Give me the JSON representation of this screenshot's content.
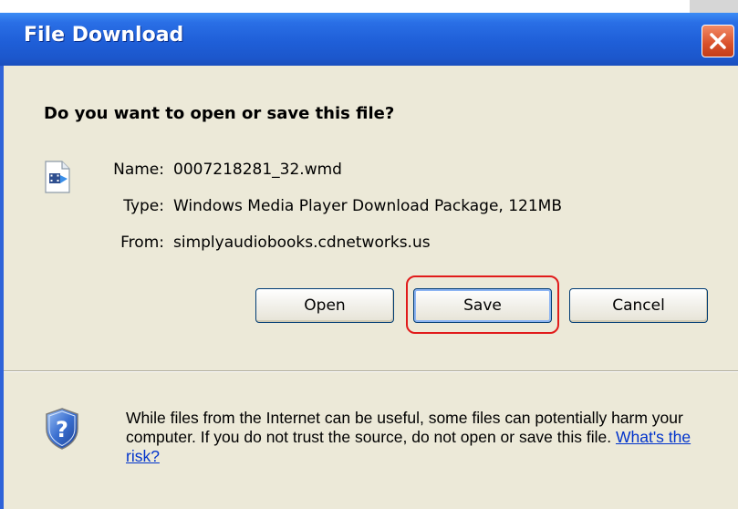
{
  "window": {
    "title": "File Download",
    "close_icon": "close-icon"
  },
  "dialog": {
    "question": "Do you want to open or save this file?",
    "file_icon": "media-file-icon",
    "fields": [
      {
        "label": "Name:",
        "value": "0007218281_32.wmd"
      },
      {
        "label": "Type:",
        "value": "Windows Media Player Download Package, 121MB"
      },
      {
        "label": "From:",
        "value": "simplyaudiobooks.cdnetworks.us"
      }
    ],
    "buttons": {
      "open": "Open",
      "save": "Save",
      "cancel": "Cancel"
    },
    "highlight_color": "#e11b1b"
  },
  "warning": {
    "icon": "shield-question-icon",
    "text": "While files from the Internet can be useful, some files can potentially harm your computer. If you do not trust the source, do not open or save this file.",
    "link": "What's the risk?"
  }
}
